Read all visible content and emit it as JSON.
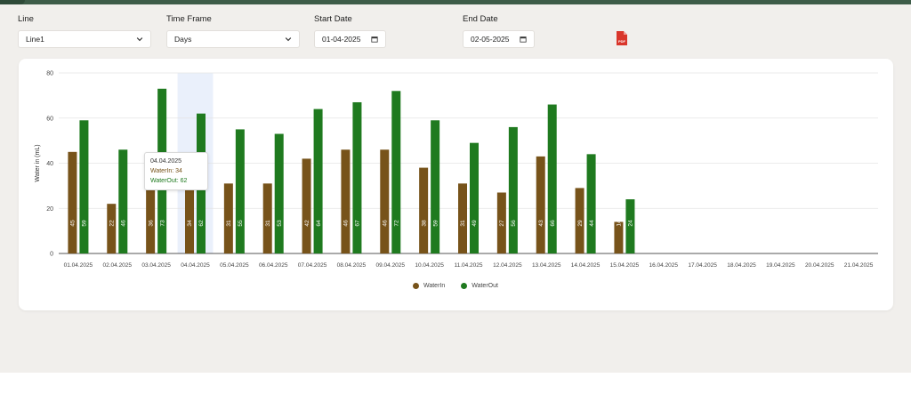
{
  "filters": {
    "line": {
      "label": "Line",
      "value": "Line1"
    },
    "time_frame": {
      "label": "Time Frame",
      "value": "Days"
    },
    "start_date": {
      "label": "Start Date",
      "value": "01-04-2025"
    },
    "end_date": {
      "label": "End Date",
      "value": "02-05-2025"
    }
  },
  "pdf_button": {
    "icon": "pdf-icon",
    "text": "PDF",
    "color": "#d9362b"
  },
  "tooltip": {
    "date": "04.04.2025",
    "water_in": "WaterIn: 34",
    "water_out": "WaterOut: 62"
  },
  "colors": {
    "water_in": "#77531a",
    "water_out": "#1f7a1f",
    "highlight": "#eaf0fb"
  },
  "chart_data": {
    "type": "bar",
    "ylabel": "Water in (mL)",
    "xlabel": "",
    "ylim": [
      0,
      80
    ],
    "yticks": [
      0,
      20,
      40,
      60,
      80
    ],
    "grid": true,
    "legend_position": "bottom",
    "highlighted_category": "04.04.2025",
    "categories": [
      "01.04.2025",
      "02.04.2025",
      "03.04.2025",
      "04.04.2025",
      "05.04.2025",
      "06.04.2025",
      "07.04.2025",
      "08.04.2025",
      "09.04.2025",
      "10.04.2025",
      "11.04.2025",
      "12.04.2025",
      "13.04.2025",
      "14.04.2025",
      "15.04.2025",
      "16.04.2025",
      "17.04.2025",
      "18.04.2025",
      "19.04.2025",
      "20.04.2025",
      "21.04.2025"
    ],
    "series": [
      {
        "name": "WaterIn",
        "values": [
          45,
          22,
          36,
          34,
          31,
          31,
          42,
          46,
          46,
          38,
          31,
          27,
          43,
          29,
          14,
          0,
          0,
          0,
          0,
          0,
          0
        ]
      },
      {
        "name": "WaterOut",
        "values": [
          59,
          46,
          73,
          62,
          55,
          53,
          64,
          67,
          72,
          59,
          49,
          56,
          66,
          44,
          24,
          0,
          0,
          0,
          0,
          0,
          0
        ]
      }
    ]
  }
}
